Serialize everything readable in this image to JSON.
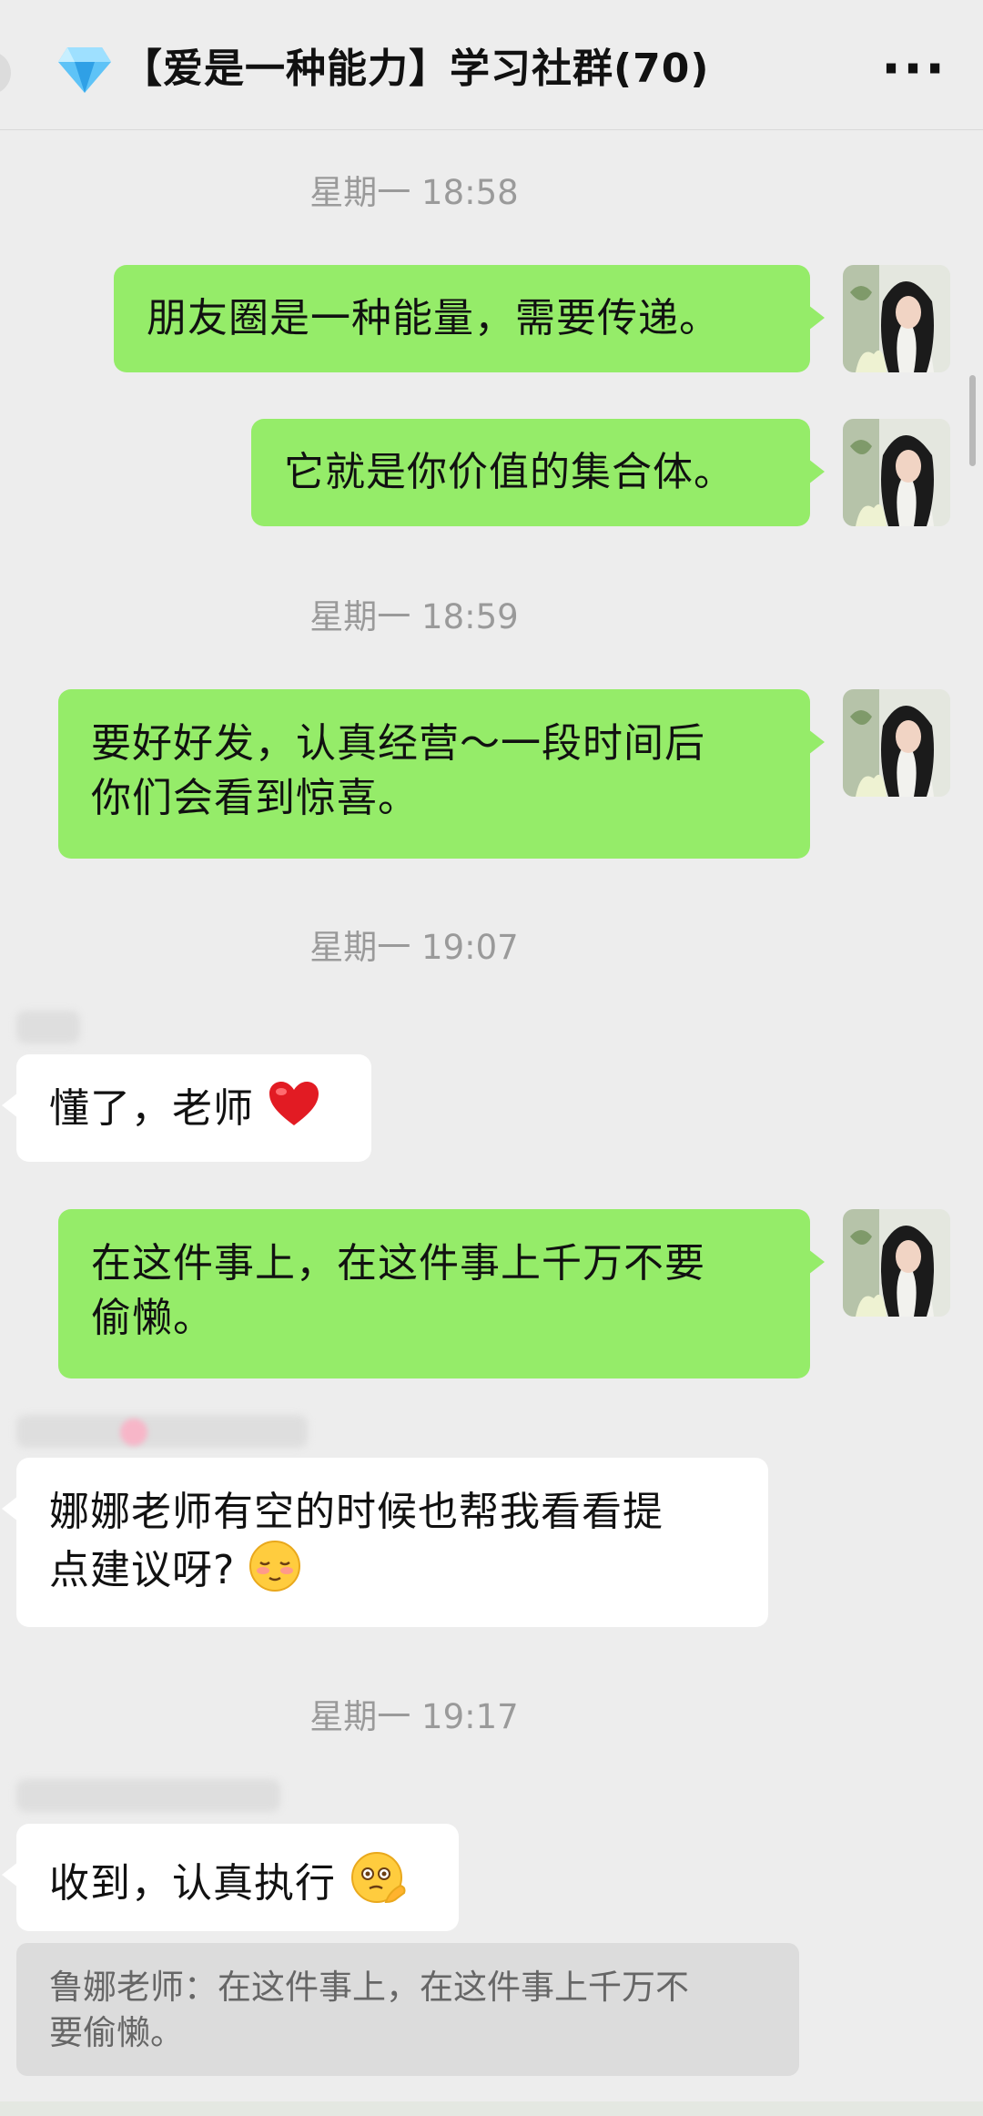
{
  "header": {
    "title": "【爱是一种能力】学习社群(70)",
    "more_label": "···",
    "icon": "gem-icon"
  },
  "colors": {
    "sent_bubble": "#95ec69",
    "received_bubble": "#ffffff",
    "background": "#ededed",
    "timestamp": "#9a9a9a"
  },
  "timestamps": [
    "星期一 18:58",
    "星期一 18:59",
    "星期一 19:07",
    "星期一 19:17"
  ],
  "messages": [
    {
      "side": "right",
      "text": "朋友圈是一种能量，需要传递。"
    },
    {
      "side": "right",
      "text": "它就是你价值的集合体。"
    },
    {
      "side": "right",
      "lines": [
        "要好好发，认真经营～一段时间后",
        "你们会看到惊喜。"
      ]
    },
    {
      "side": "left",
      "text": "懂了，老师",
      "emoji": "red-heart-icon"
    },
    {
      "side": "right",
      "lines": [
        "在这件事上，在这件事上千万不要",
        "偷懒。"
      ]
    },
    {
      "side": "left",
      "lines": [
        "娜娜老师有空的时候也帮我看看提",
        "点建议呀?"
      ],
      "emoji": "shy-face-icon"
    },
    {
      "side": "left",
      "text": "收到，认真执行",
      "emoji": "salute-face-icon"
    }
  ],
  "quote": {
    "lines": [
      "鲁娜老师：在这件事上，在这件事上千万不",
      "要偷懒。"
    ]
  }
}
